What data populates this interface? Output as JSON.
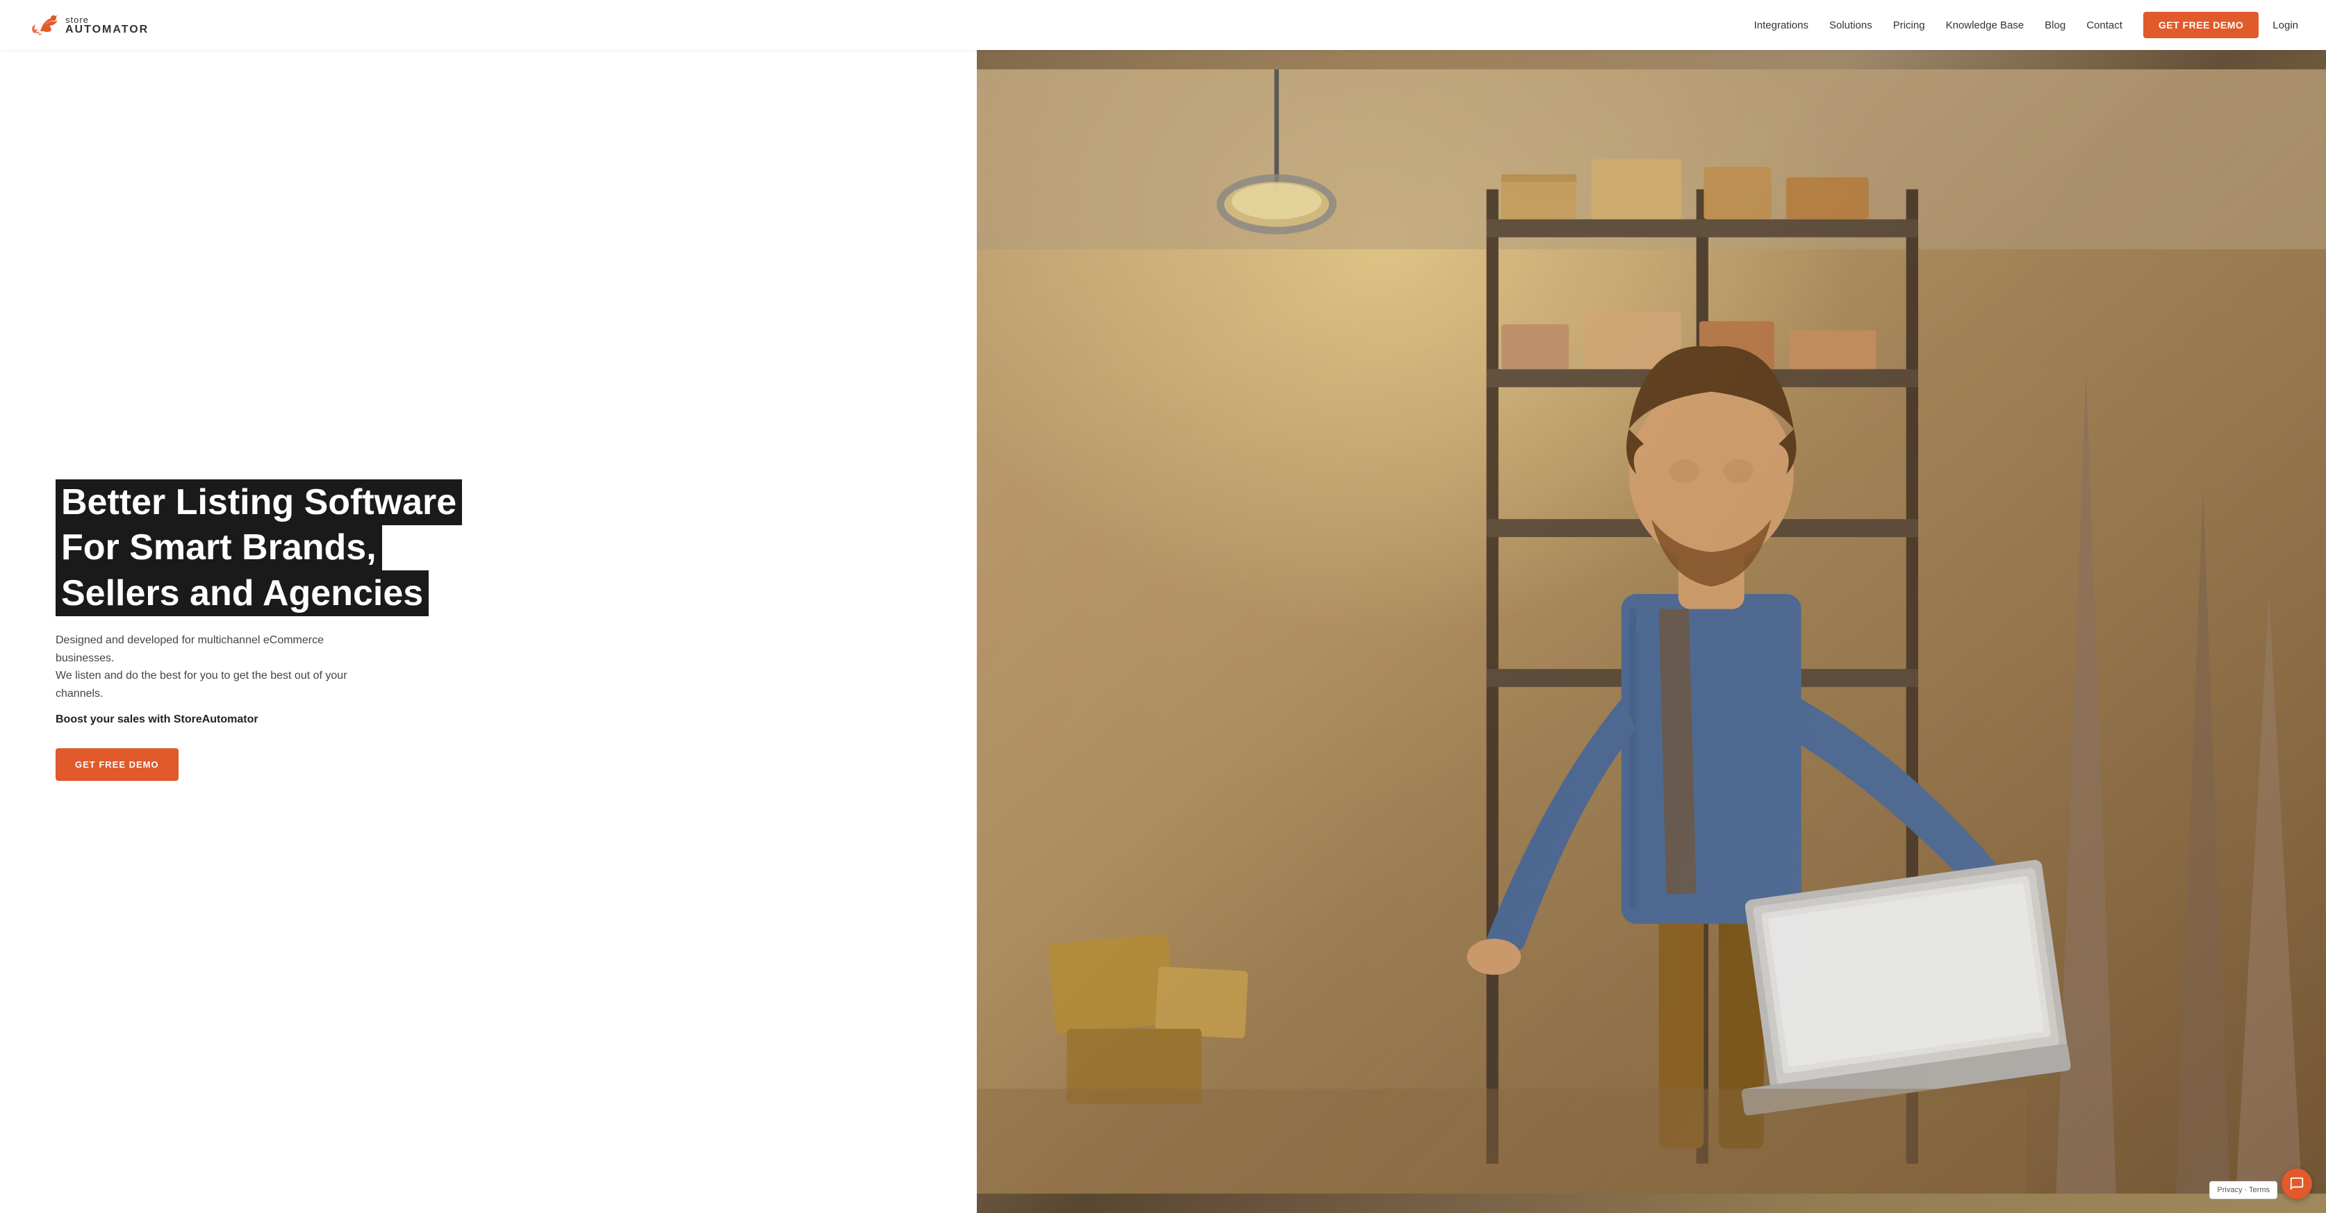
{
  "header": {
    "logo": {
      "store_label": "store",
      "automator_label": "AUTOMATOR"
    },
    "nav": {
      "integrations": "Integrations",
      "solutions": "Solutions",
      "pricing": "Pricing",
      "knowledge_base": "Knowledge Base",
      "blog": "Blog",
      "contact": "Contact",
      "get_free_demo": "GET FREE DEMO",
      "login": "Login"
    }
  },
  "hero": {
    "heading_line1": "Better Listing Software",
    "heading_line2": "For Smart Brands,",
    "heading_line3": "Sellers and Agencies",
    "description_line1": "Designed and developed for multichannel eCommerce businesses.",
    "description_line2": "We listen and do the best for you to get the best out of your",
    "description_line3": "channels.",
    "boost_text": "Boost your sales with StoreAutomator",
    "cta_button": "GET FREE DEMO"
  },
  "chat": {
    "label": "Chat"
  },
  "privacy": {
    "text": "Privacy · Terms"
  },
  "colors": {
    "accent": "#e05a2b",
    "dark": "#1a1a1a",
    "white": "#ffffff"
  }
}
